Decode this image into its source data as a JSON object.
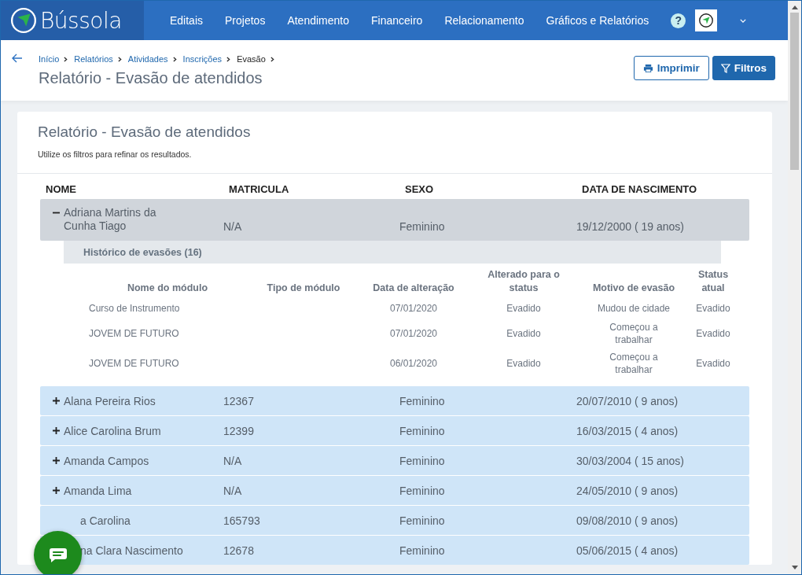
{
  "nav": {
    "brand": "Bússola",
    "items": [
      "Editais",
      "Projetos",
      "Atendimento",
      "Financeiro",
      "Relacionamento",
      "Gráficos e Relatórios"
    ],
    "help": "?"
  },
  "breadcrumb": [
    {
      "label": "Início",
      "link": true
    },
    {
      "label": "Relatórios",
      "link": true
    },
    {
      "label": "Atividades",
      "link": true
    },
    {
      "label": "Inscrições",
      "link": true
    },
    {
      "label": "Evasão",
      "link": false
    }
  ],
  "page_title": "Relatório - Evasão de atendidos",
  "buttons": {
    "print": "Imprimir",
    "filter": "Filtros"
  },
  "card": {
    "title": "Relatório - Evasão de atendidos",
    "subtitle": "Utilize os filtros para refinar os resultados."
  },
  "table": {
    "columns": [
      "NOME",
      "MATRICULA",
      "SEXO",
      "DATA DE NASCIMENTO"
    ],
    "rows": [
      {
        "name": "Adriana Martins da Cunha Tiago",
        "matricula": "N/A",
        "sexo": "Feminino",
        "birth": "19/12/2000 ( 19 anos)",
        "expanded": true,
        "history": {
          "title": "Histórico de evasões (16)",
          "columns": [
            "Nome do módulo",
            "Tipo de módulo",
            "Data de alteração",
            "Alterado para o status",
            "Motivo de evasão",
            "Status atual"
          ],
          "rows": [
            [
              "Curso de Instrumento",
              "",
              "07/01/2020",
              "Evadido",
              "Mudou de cidade",
              "Evadido"
            ],
            [
              "JOVEM DE FUTURO",
              "",
              "07/01/2020",
              "Evadido",
              "Começou a trabalhar",
              "Evadido"
            ],
            [
              "JOVEM DE FUTURO",
              "",
              "06/01/2020",
              "Evadido",
              "Começou a trabalhar",
              "Evadido"
            ]
          ]
        }
      },
      {
        "name": "Alana Pereira Rios",
        "matricula": "12367",
        "sexo": "Feminino",
        "birth": "20/07/2010 ( 9 anos)",
        "expanded": false
      },
      {
        "name": "Alice Carolina Brum",
        "matricula": "12399",
        "sexo": "Feminino",
        "birth": "16/03/2015 ( 4 anos)",
        "expanded": false
      },
      {
        "name": "Amanda Campos",
        "matricula": "N/A",
        "sexo": "Feminino",
        "birth": "30/03/2004 ( 15 anos)",
        "expanded": false
      },
      {
        "name": "Amanda Lima",
        "matricula": "N/A",
        "sexo": "Feminino",
        "birth": "24/05/2010 ( 9 anos)",
        "expanded": false
      },
      {
        "name": "a Carolina",
        "matricula": "165793",
        "sexo": "Feminino",
        "birth": "09/08/2010 ( 9 anos)"
      },
      {
        "name": "na Clara Nascimento",
        "matricula": "12678",
        "sexo": "Feminino",
        "birth": "05/06/2015 ( 4 anos)"
      }
    ]
  }
}
